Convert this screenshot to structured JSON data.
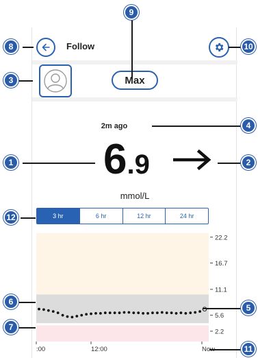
{
  "header": {
    "title": "Follow"
  },
  "profile": {
    "name": "Max"
  },
  "reading": {
    "time_ago": "2m ago",
    "value_int": "6",
    "value_dec": ".9",
    "unit": "mmol/L",
    "trend": "right-arrow-icon"
  },
  "tabs": [
    {
      "label": "3 hr",
      "active": true
    },
    {
      "label": "6 hr",
      "active": false
    },
    {
      "label": "12 hr",
      "active": false
    },
    {
      "label": "24 hr",
      "active": false
    }
  ],
  "chart_data": {
    "type": "scatter",
    "x_tick_labels": [
      ":00",
      "12:00",
      "Now"
    ],
    "y_ticks": [
      22.2,
      16.7,
      11.1,
      5.6,
      2.2
    ],
    "target_range": [
      3.9,
      10.0
    ],
    "high_zone": [
      10.0,
      22.2
    ],
    "low_zone": [
      0,
      3.9
    ],
    "ylim": [
      0,
      22.2
    ],
    "x": [
      0,
      1,
      2,
      3,
      4,
      5,
      6,
      7,
      8,
      9,
      10,
      11,
      12,
      13,
      14,
      15,
      16,
      17,
      18,
      19,
      20,
      21,
      22,
      23,
      24,
      25,
      26,
      27,
      28,
      29,
      30,
      31,
      32,
      33,
      34,
      35
    ],
    "values": [
      6.9,
      6.8,
      6.6,
      6.4,
      6.1,
      5.6,
      5.3,
      5.2,
      5.4,
      5.6,
      5.8,
      5.9,
      6.0,
      6.0,
      6.1,
      6.1,
      6.1,
      6.1,
      6.2,
      6.2,
      6.1,
      6.1,
      6.0,
      6.0,
      6.1,
      6.1,
      6.2,
      6.1,
      6.1,
      6.0,
      6.1,
      6.0,
      6.1,
      6.2,
      6.4,
      6.9
    ],
    "colors": {
      "high": "#fff5e6",
      "target": "#dcdcdc",
      "low": "#fce6ea",
      "point": "#111111"
    }
  },
  "colors": {
    "accent": "#2a62b3",
    "badge": "#2b5caa"
  },
  "callouts": [
    "1",
    "2",
    "3",
    "4",
    "5",
    "6",
    "7",
    "8",
    "9",
    "10",
    "11",
    "12"
  ]
}
